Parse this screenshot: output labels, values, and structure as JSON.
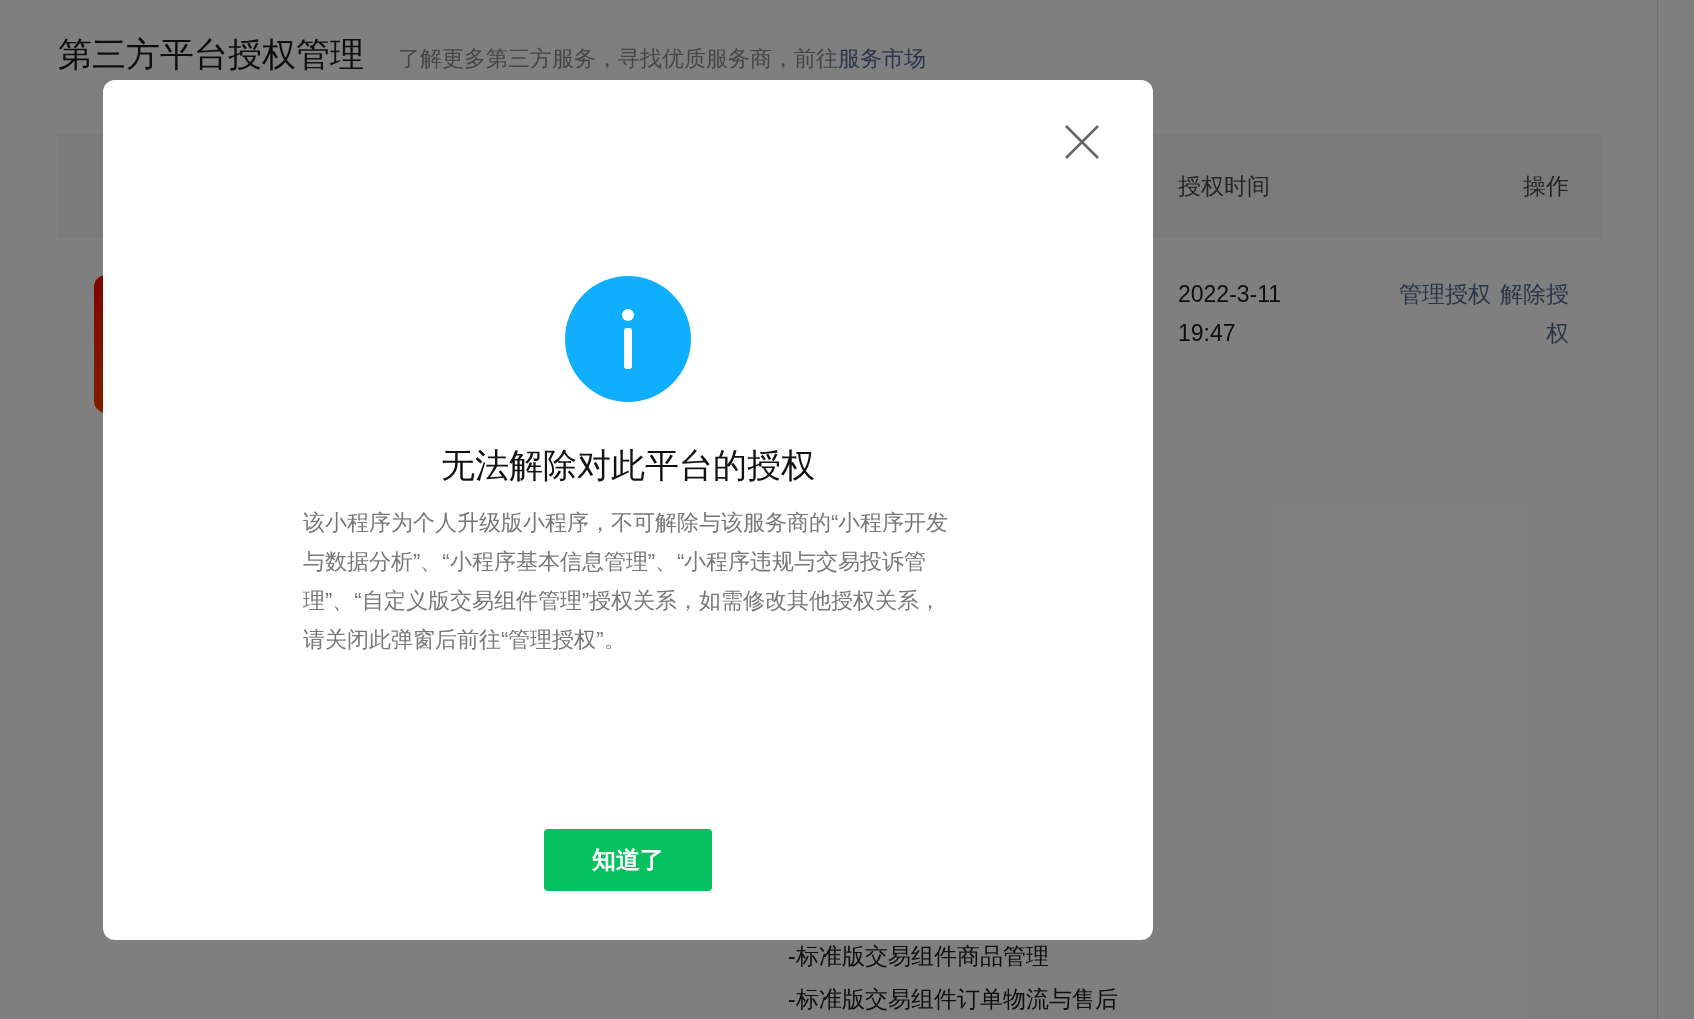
{
  "page": {
    "title": "第三方平台授权管理",
    "subtitle": "了解更多第三方服务，寻找优质服务商，前往",
    "subtitle_link": "服务市场"
  },
  "table": {
    "columns": [
      "授权时间",
      "操作"
    ],
    "rows": [
      {
        "permissions": [
          "-标准版交易组件商品管理",
          "-标准版交易组件订单物流与售后"
        ],
        "time": "2022-3-11 19:47",
        "actions": [
          "管理授权",
          "解除授权"
        ]
      }
    ]
  },
  "dialog": {
    "title": "无法解除对此平台的授权",
    "message": "该小程序为个人升级版小程序，不可解除与该服务商的“小程序开发与数据分析”、“小程序基本信息管理”、“小程序违规与交易投诉管理”、“自定义版交易组件管理”授权关系，如需修改其他授权关系，请关闭此弹窗后前往“管理授权”。",
    "button": "知道了"
  }
}
